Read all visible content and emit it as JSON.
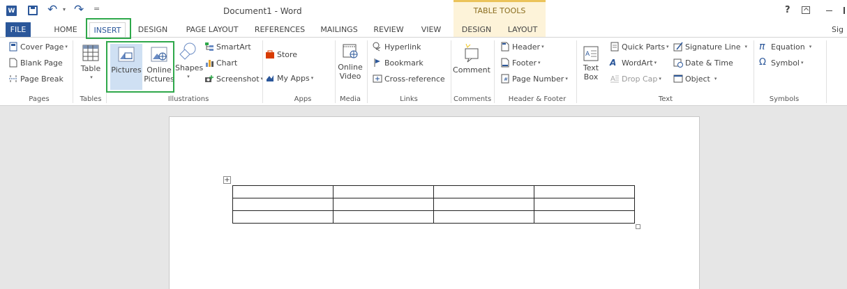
{
  "title_bar": {
    "document_title": "Document1 - Word",
    "context_tools_label": "TABLE TOOLS",
    "help_label": "?"
  },
  "tabs": [
    "FILE",
    "HOME",
    "INSERT",
    "DESIGN",
    "PAGE LAYOUT",
    "REFERENCES",
    "MAILINGS",
    "REVIEW",
    "VIEW",
    "DESIGN",
    "LAYOUT"
  ],
  "active_tab": "INSERT",
  "sign_in": "Sig",
  "ribbon": {
    "pages": {
      "label": "Pages",
      "cover_page": "Cover Page",
      "blank_page": "Blank Page",
      "page_break": "Page Break"
    },
    "tables": {
      "label": "Tables",
      "table": "Table"
    },
    "illustrations": {
      "label": "Illustrations",
      "pictures": "Pictures",
      "online_pictures_1": "Online",
      "online_pictures_2": "Pictures",
      "shapes": "Shapes",
      "smartart": "SmartArt",
      "chart": "Chart",
      "screenshot": "Screenshot"
    },
    "apps": {
      "label": "Apps",
      "store": "Store",
      "my_apps": "My Apps"
    },
    "media": {
      "label": "Media",
      "online_video_1": "Online",
      "online_video_2": "Video"
    },
    "links": {
      "label": "Links",
      "hyperlink": "Hyperlink",
      "bookmark": "Bookmark",
      "cross_reference": "Cross-reference"
    },
    "comments": {
      "label": "Comments",
      "comment": "Comment"
    },
    "header_footer": {
      "label": "Header & Footer",
      "header": "Header",
      "footer": "Footer",
      "page_number": "Page Number"
    },
    "text": {
      "label": "Text",
      "text_box_1": "Text",
      "text_box_2": "Box",
      "quick_parts": "Quick Parts",
      "wordart": "WordArt",
      "drop_cap": "Drop Cap",
      "signature_line": "Signature Line",
      "date_time": "Date & Time",
      "object": "Object"
    },
    "symbols": {
      "label": "Symbols",
      "equation": "Equation",
      "symbol": "Symbol"
    }
  },
  "document": {
    "table": {
      "rows": 3,
      "cols": 4
    }
  },
  "colors": {
    "word_blue": "#2b579a",
    "highlight_green": "#2ea84a",
    "context_tab": "#fdf3d9"
  }
}
